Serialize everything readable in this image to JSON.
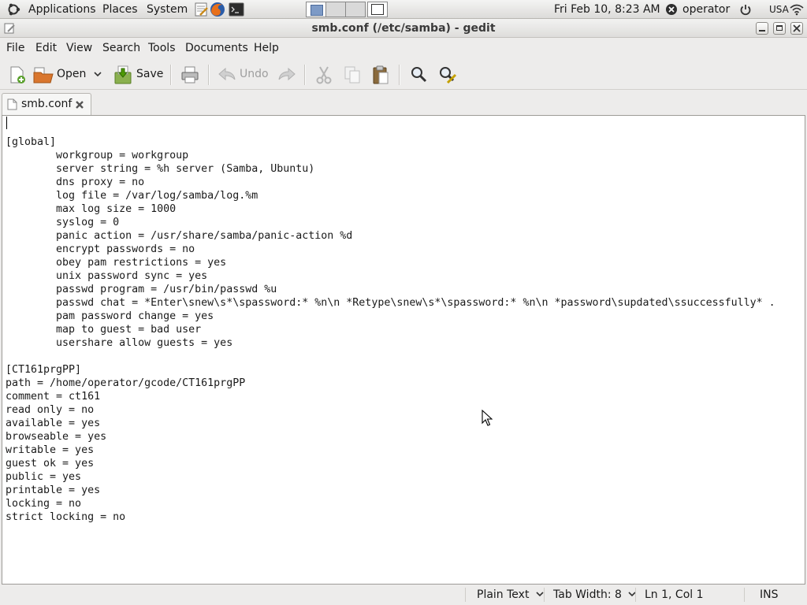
{
  "panel": {
    "applications": "Applications",
    "places": "Places",
    "system": "System",
    "clock": "Fri Feb 10,  8:23 AM",
    "user": "operator",
    "keyboard": "USA"
  },
  "window": {
    "title": "smb.conf (/etc/samba) - gedit"
  },
  "menu": {
    "file": "File",
    "edit": "Edit",
    "view": "View",
    "search": "Search",
    "tools": "Tools",
    "documents": "Documents",
    "help": "Help"
  },
  "toolbar": {
    "open": "Open",
    "save": "Save",
    "undo": "Undo"
  },
  "tab": {
    "label": "smb.conf"
  },
  "document": {
    "lines": [
      "",
      "[global]",
      "        workgroup = workgroup",
      "        server string = %h server (Samba, Ubuntu)",
      "        dns proxy = no",
      "        log file = /var/log/samba/log.%m",
      "        max log size = 1000",
      "        syslog = 0",
      "        panic action = /usr/share/samba/panic-action %d",
      "        encrypt passwords = no",
      "        obey pam restrictions = yes",
      "        unix password sync = yes",
      "        passwd program = /usr/bin/passwd %u",
      "        passwd chat = *Enter\\snew\\s*\\spassword:* %n\\n *Retype\\snew\\s*\\spassword:* %n\\n *password\\supdated\\ssuccessfully* .",
      "        pam password change = yes",
      "        map to guest = bad user",
      "        usershare allow guests = yes",
      "",
      "[CT161prgPP]",
      "path = /home/operator/gcode/CT161prgPP",
      "comment = ct161",
      "read only = no",
      "available = yes",
      "browseable = yes",
      "writable = yes",
      "guest ok = yes",
      "public = yes",
      "printable = yes",
      "locking = no",
      "strict locking = no"
    ]
  },
  "status": {
    "language": "Plain Text",
    "tab_width": "Tab Width:  8",
    "position": "Ln 1, Col 1",
    "mode": "INS"
  }
}
